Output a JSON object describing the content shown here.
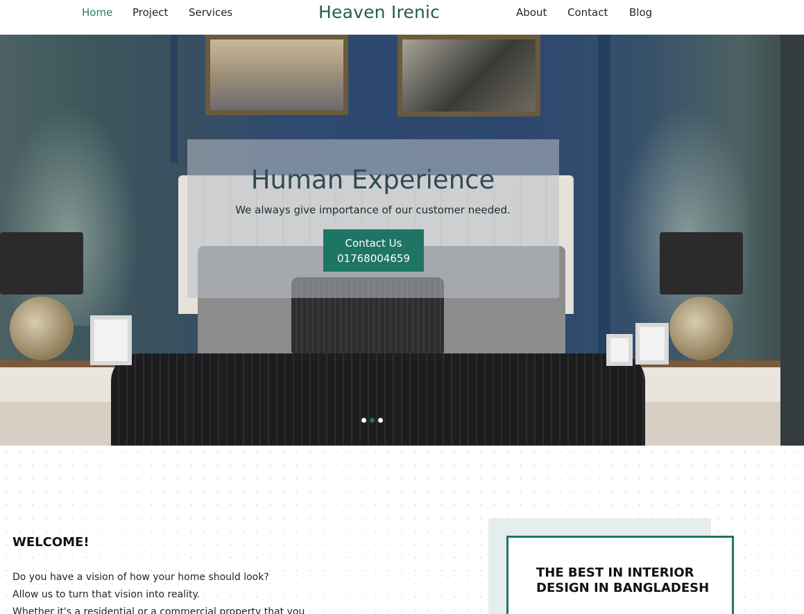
{
  "nav": {
    "left_items": [
      "Home",
      "Project",
      "Services"
    ],
    "brand": "Heaven Irenic",
    "right_items": [
      "About",
      "Contact",
      "Blog"
    ],
    "active": "Home"
  },
  "hero": {
    "title": "Human Experience",
    "subtitle": "We always give importance of our customer needed.",
    "cta_line1": "Contact Us",
    "cta_line2": "01768004659",
    "slide_count": 3,
    "active_slide": 2
  },
  "welcome": {
    "heading": "WELCOME!",
    "lines": [
      "Do you have a vision of how your home should look?",
      "Allow us to turn that vision into reality.",
      "Whether it's a residential or a commercial property that you"
    ]
  },
  "feature": {
    "title": "THE BEST IN INTERIOR DESIGN IN BANGLADESH"
  },
  "colors": {
    "accent": "#1f7564",
    "brand_text": "#235e56",
    "panel_bg": "#e6eded"
  }
}
